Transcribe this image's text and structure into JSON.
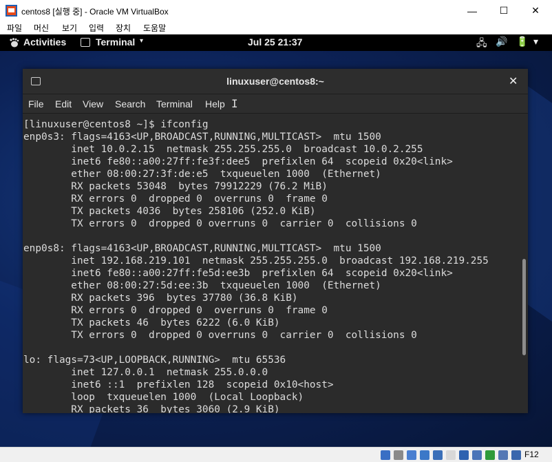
{
  "vbox": {
    "title": "centos8 [실행 중] - Oracle VM VirtualBox",
    "menu": [
      "파일",
      "머신",
      "보기",
      "입력",
      "장치",
      "도움말"
    ],
    "min_glyph": "—",
    "max_glyph": "☐",
    "close_glyph": "✕",
    "host_key": "F12"
  },
  "gnome": {
    "activities": "Activities",
    "app_name": "Terminal",
    "app_arrow": "▾",
    "clock": "Jul 25  21:37",
    "tray": {
      "network": "🖧",
      "volume": "🔊",
      "battery": "🔋",
      "menu_arrow": "▾"
    }
  },
  "terminal": {
    "title": "linuxuser@centos8:~",
    "close_glyph": "✕",
    "cursor_glyph": "I",
    "menu": [
      "File",
      "Edit",
      "View",
      "Search",
      "Terminal",
      "Help"
    ],
    "lines": [
      "[linuxuser@centos8 ~]$ ifconfig",
      "enp0s3: flags=4163<UP,BROADCAST,RUNNING,MULTICAST>  mtu 1500",
      "        inet 10.0.2.15  netmask 255.255.255.0  broadcast 10.0.2.255",
      "        inet6 fe80::a00:27ff:fe3f:dee5  prefixlen 64  scopeid 0x20<link>",
      "        ether 08:00:27:3f:de:e5  txqueuelen 1000  (Ethernet)",
      "        RX packets 53048  bytes 79912229 (76.2 MiB)",
      "        RX errors 0  dropped 0  overruns 0  frame 0",
      "        TX packets 4036  bytes 258106 (252.0 KiB)",
      "        TX errors 0  dropped 0 overruns 0  carrier 0  collisions 0",
      "",
      "enp0s8: flags=4163<UP,BROADCAST,RUNNING,MULTICAST>  mtu 1500",
      "        inet 192.168.219.101  netmask 255.255.255.0  broadcast 192.168.219.255",
      "        inet6 fe80::a00:27ff:fe5d:ee3b  prefixlen 64  scopeid 0x20<link>",
      "        ether 08:00:27:5d:ee:3b  txqueuelen 1000  (Ethernet)",
      "        RX packets 396  bytes 37780 (36.8 KiB)",
      "        RX errors 0  dropped 0  overruns 0  frame 0",
      "        TX packets 46  bytes 6222 (6.0 KiB)",
      "        TX errors 0  dropped 0 overruns 0  carrier 0  collisions 0",
      "",
      "lo: flags=73<UP,LOOPBACK,RUNNING>  mtu 65536",
      "        inet 127.0.0.1  netmask 255.0.0.0",
      "        inet6 ::1  prefixlen 128  scopeid 0x10<host>",
      "        loop  txqueuelen 1000  (Local Loopback)",
      "        RX packets 36  bytes 3060 (2.9 KiB)"
    ]
  },
  "status_icons": [
    {
      "name": "hard-disk-icon",
      "color": "#3a6fc4"
    },
    {
      "name": "optical-drive-icon",
      "color": "#8a8a8a"
    },
    {
      "name": "audio-icon",
      "color": "#4a7fd0"
    },
    {
      "name": "network-icon",
      "color": "#3b78c8"
    },
    {
      "name": "usb-icon",
      "color": "#3b6fb8"
    },
    {
      "name": "shared-folder-icon",
      "color": "#d8d8d8"
    },
    {
      "name": "display-icon",
      "color": "#2e62b0"
    },
    {
      "name": "video-capture-icon",
      "color": "#4a74b8"
    },
    {
      "name": "cpu-icon",
      "color": "#2f9a3a"
    },
    {
      "name": "mouse-integration-icon",
      "color": "#5578b5"
    },
    {
      "name": "keyboard-icon",
      "color": "#3a67ad"
    }
  ]
}
